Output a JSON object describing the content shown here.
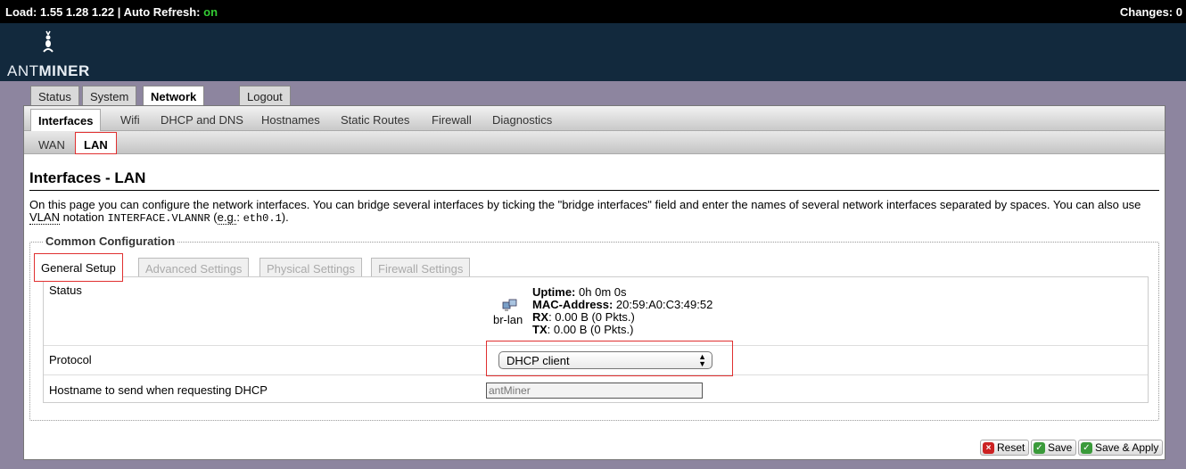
{
  "topbar": {
    "load_label": "Load:",
    "load_values": "1.55 1.28 1.22",
    "separator": "|",
    "auto_refresh_label": "Auto Refresh:",
    "auto_refresh_value": "on",
    "changes_label": "Changes:",
    "changes_value": "0"
  },
  "logo": {
    "prefix": "ANT",
    "suffix": "MINER"
  },
  "main_tabs": [
    "Status",
    "System",
    "Network",
    "Logout"
  ],
  "main_tab_active": "Network",
  "sub_tabs": [
    "Interfaces",
    "Wifi",
    "DHCP and DNS",
    "Hostnames",
    "Static Routes",
    "Firewall",
    "Diagnostics"
  ],
  "sub_tab_active": "Interfaces",
  "iface_tabs": [
    "WAN",
    "LAN"
  ],
  "iface_tab_active": "LAN",
  "page": {
    "title": "Interfaces - LAN",
    "desc_part1": "On this page you can configure the network interfaces. You can bridge several interfaces by ticking the \"bridge interfaces\" field and enter the names of several network interfaces separated by spaces. You can also use ",
    "desc_vlan": "VLAN",
    "desc_part2": " notation ",
    "desc_code1": "INTERFACE.VLANNR",
    "desc_part3": " (",
    "desc_eg": "e.g.",
    "desc_part4": ": ",
    "desc_code2": "eth0.1",
    "desc_part5": ")."
  },
  "config": {
    "legend": "Common Configuration",
    "tabs": [
      "General Setup",
      "Advanced Settings",
      "Physical Settings",
      "Firewall Settings"
    ],
    "active_tab": "General Setup",
    "status_label": "Status",
    "interface_name": "br-lan",
    "uptime_label": "Uptime:",
    "uptime_value": "0h 0m 0s",
    "mac_label": "MAC-Address:",
    "mac_value": "20:59:A0:C3:49:52",
    "rx_label": "RX",
    "rx_value": ": 0.00 B (0 Pkts.)",
    "tx_label": "TX",
    "tx_value": ": 0.00 B (0 Pkts.)",
    "protocol_label": "Protocol",
    "protocol_value": "DHCP client",
    "hostname_label": "Hostname to send when requesting DHCP",
    "hostname_placeholder": "antMiner"
  },
  "buttons": {
    "reset": "Reset",
    "save": "Save",
    "save_apply": "Save & Apply"
  },
  "colors": {
    "topbar_bg": "#000000",
    "header_bg": "#12293d",
    "page_bg": "#8d859f",
    "accent_on": "#33cc33",
    "highlight": "#e03030"
  }
}
